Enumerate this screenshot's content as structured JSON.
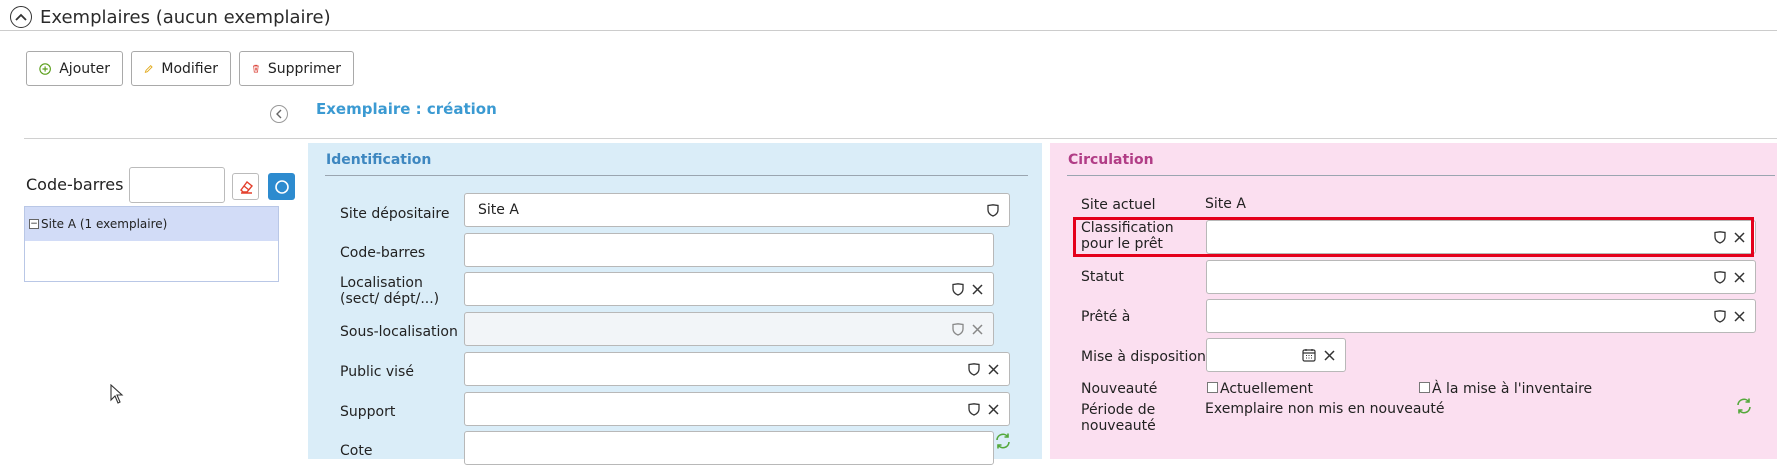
{
  "header": {
    "title": "Exemplaires (aucun exemplaire)"
  },
  "toolbar": {
    "add_label": "Ajouter",
    "edit_label": "Modifier",
    "delete_label": "Supprimer"
  },
  "form": {
    "title": "Exemplaire : création"
  },
  "left": {
    "barcode_label": "Code-barres",
    "barcode_value": "",
    "tree_item": "Site A (1 exemplaire)",
    "tree_toggle": "−"
  },
  "identification": {
    "title": "Identification",
    "site_label": "Site dépositaire",
    "site_value": "Site A",
    "barcode_label": "Code-barres",
    "barcode_value": "",
    "location_label": "Localisation (sect/ dépt/...)",
    "location_value": "",
    "sublocation_label": "Sous-localisation",
    "sublocation_value": "",
    "audience_label": "Public visé",
    "audience_value": "",
    "support_label": "Support",
    "support_value": "",
    "cote_label": "Cote",
    "cote_value": ""
  },
  "circulation": {
    "title": "Circulation",
    "current_site_label": "Site actuel",
    "current_site_value": "Site A",
    "classification_label": "Classification pour le prêt",
    "classification_value": "",
    "status_label": "Statut",
    "status_value": "",
    "lent_to_label": "Prêté à",
    "lent_to_value": "",
    "availability_label": "Mise à disposition",
    "availability_value": "",
    "novelty_label": "Nouveauté",
    "novelty_current_label": "Actuellement",
    "novelty_inventory_label": "À la mise à l'inventaire",
    "novelty_period_label": "Période de nouveauté",
    "novelty_period_value": "Exemplaire non mis en nouveauté"
  },
  "colors": {
    "accent": "#3b9ad2",
    "identification_bg": "#daedf8",
    "circulation_bg": "#fbdff0",
    "highlight": "#e4001b"
  }
}
